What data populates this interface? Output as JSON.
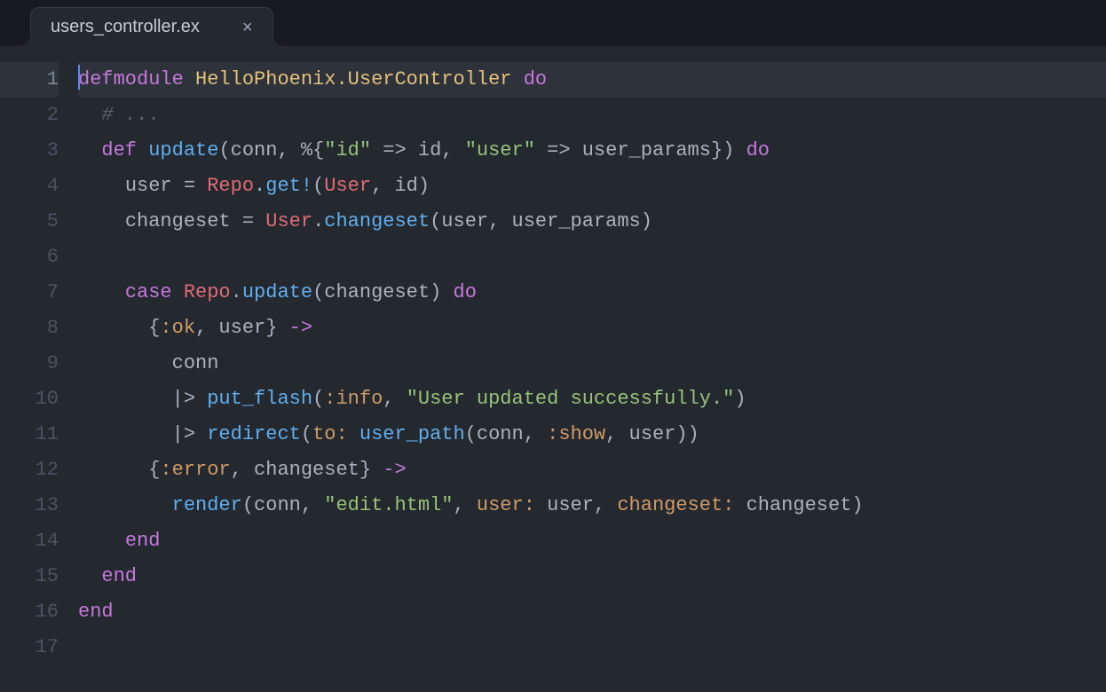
{
  "tab": {
    "title": "users_controller.ex",
    "close_label": "×"
  },
  "gutter": {
    "lines": [
      "1",
      "2",
      "3",
      "4",
      "5",
      "6",
      "7",
      "8",
      "9",
      "10",
      "11",
      "12",
      "13",
      "14",
      "15",
      "16",
      "17"
    ]
  },
  "code": {
    "l1": {
      "kw1": "defmodule ",
      "mod": "HelloPhoenix.UserController",
      "sp": " ",
      "kw2": "do"
    },
    "l2": {
      "indent": "  ",
      "comment": "# ..."
    },
    "l3": {
      "indent": "  ",
      "kw": "def ",
      "fn": "update",
      "p1": "(conn, ",
      "pct": "%",
      "br1": "{",
      "s1": "\"id\"",
      "ar1": " => ",
      "v1": "id, ",
      "s2": "\"user\"",
      "ar2": " => ",
      "v2": "user_params",
      "br2": "}",
      "p2": ") ",
      "do": "do"
    },
    "l4": {
      "indent": "    ",
      "v1": "user ",
      "op": "= ",
      "cls": "Repo",
      "dot": ".",
      "fn": "get!",
      "p1": "(",
      "cls2": "User",
      "p2": ", id)"
    },
    "l5": {
      "indent": "    ",
      "v1": "changeset ",
      "op": "= ",
      "cls": "User",
      "dot": ".",
      "fn": "changeset",
      "p": "(user, user_params)"
    },
    "l6": {
      "indent": ""
    },
    "l7": {
      "indent": "    ",
      "kw": "case ",
      "cls": "Repo",
      "dot": ".",
      "fn": "update",
      "p": "(changeset) ",
      "do": "do"
    },
    "l8": {
      "indent": "      ",
      "br1": "{",
      "atom": ":ok",
      "rest": ", user} ",
      "arrow": "->"
    },
    "l9": {
      "indent": "        ",
      "v": "conn"
    },
    "l10": {
      "indent": "        ",
      "pipe": "|> ",
      "fn": "put_flash",
      "p1": "(",
      "atom": ":info",
      "p2": ", ",
      "str": "\"User updated successfully.\"",
      "p3": ")"
    },
    "l11": {
      "indent": "        ",
      "pipe": "|> ",
      "fn": "redirect",
      "p1": "(",
      "atom": "to:",
      "sp": " ",
      "fn2": "user_path",
      "p2": "(conn, ",
      "atom2": ":show",
      "p3": ", user))"
    },
    "l12": {
      "indent": "      ",
      "br1": "{",
      "atom": ":error",
      "rest": ", changeset} ",
      "arrow": "->"
    },
    "l13": {
      "indent": "        ",
      "fn": "render",
      "p1": "(conn, ",
      "str": "\"edit.html\"",
      "p2": ", ",
      "atom1": "user:",
      "v1": " user, ",
      "atom2": "changeset:",
      "v2": " changeset)"
    },
    "l14": {
      "indent": "    ",
      "kw": "end"
    },
    "l15": {
      "indent": "  ",
      "kw": "end"
    },
    "l16": {
      "indent": "",
      "kw": "end"
    },
    "l17": {
      "indent": ""
    }
  }
}
